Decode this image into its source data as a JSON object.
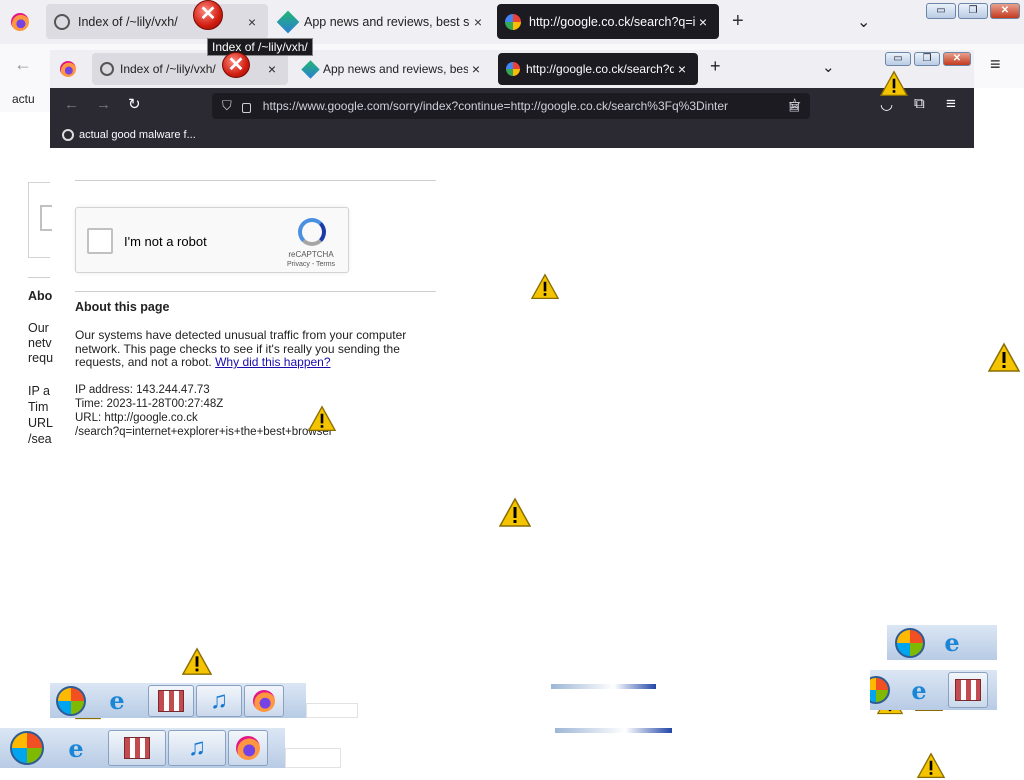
{
  "outer_window": {
    "tabs": [
      {
        "title": "Index of /~lily/vxh/"
      },
      {
        "title": "App news and reviews, best soft"
      },
      {
        "title": "http://google.co.ck/search?q=i"
      }
    ],
    "new_tab": "+",
    "tab_list": "⌄",
    "tooltip": "Index of /~lily/vxh/",
    "bookmark_fragment": "actu",
    "page_fragments": [
      "Abo",
      "Our",
      "netv",
      "requ",
      "IP a",
      "Tim",
      "URL",
      "/sea"
    ]
  },
  "inner_window": {
    "tabs": [
      {
        "title": "Index of /~lily/vxh/"
      },
      {
        "title": "App news and reviews, best soft"
      },
      {
        "title": "http://google.co.ck/search?q=i"
      }
    ],
    "new_tab": "+",
    "tab_list": "⌄",
    "url": "https://www.google.com/sorry/index?continue=http://google.co.ck/search%3Fq%3Dinter",
    "bookmark": "actual good malware f..."
  },
  "captcha": {
    "checkbox_label": "I'm not a robot",
    "brand": "reCAPTCHA",
    "privacy": "Privacy",
    "terms_sep": " - ",
    "terms": "Terms"
  },
  "about": {
    "heading": "About this page",
    "paragraph": "Our systems have detected unusual traffic from your computer network. This page checks to see if it's really you sending the requests, and not a robot.",
    "link": "Why did this happen?",
    "ip": "IP address: 143.244.47.73",
    "time": "Time: 2023-11-28T00:27:48Z",
    "url_line1": "URL: http://google.co.ck",
    "url_line2": "/search?q=internet+explorer+is+the+best+browser"
  },
  "icons": {
    "close": "×",
    "minimize": "▭",
    "restore": "❐",
    "win_close": "✕",
    "back": "←",
    "forward": "→",
    "reload": "↻",
    "shield": "⛉",
    "lock": "🔒",
    "reader": "▤",
    "star": "☆",
    "pocket": "◡",
    "extensions": "⧉",
    "menu": "≡",
    "err": "✕",
    "ie": "e",
    "music": "♫"
  },
  "colors": {
    "active_tab_dark": "#1c1b22",
    "toolbar_dark": "#2b2a33",
    "link": "#1a0dab",
    "warning_yellow": "#f5c400"
  }
}
